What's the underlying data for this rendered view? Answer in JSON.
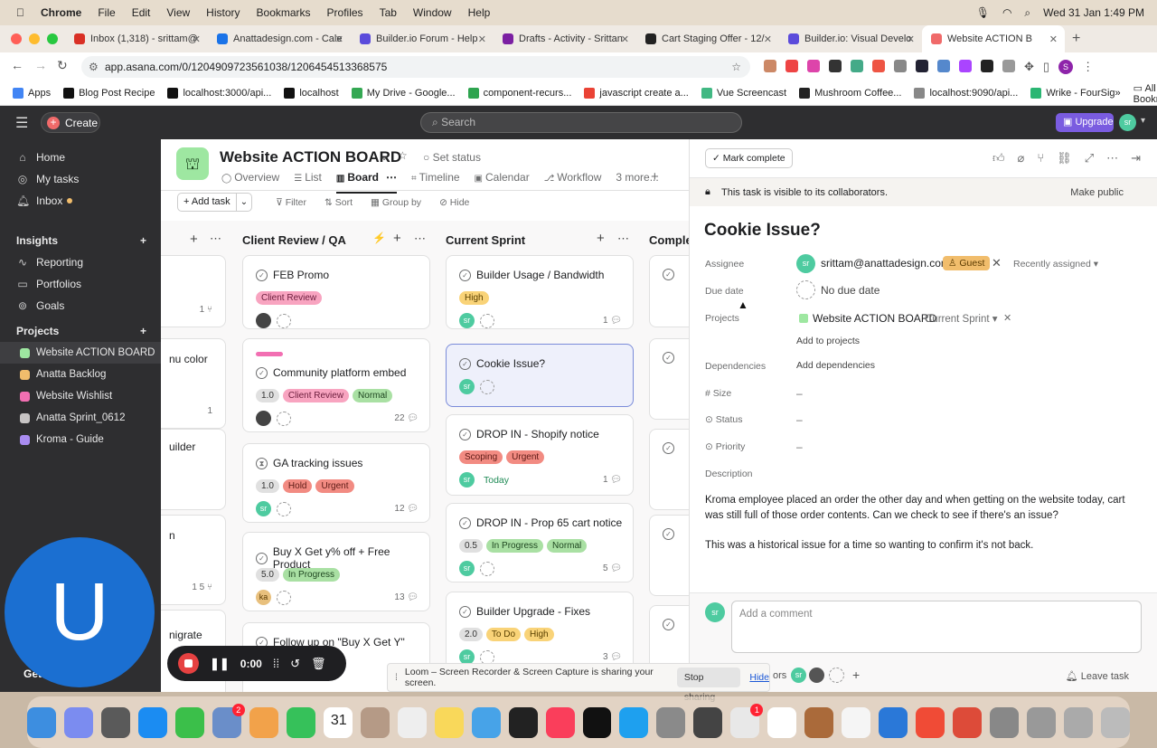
{
  "menubar": {
    "app": "Chrome",
    "items": [
      "File",
      "Edit",
      "View",
      "History",
      "Bookmarks",
      "Profiles",
      "Tab",
      "Window",
      "Help"
    ],
    "clock": "Wed 31 Jan  1:49 PM"
  },
  "tabs": [
    {
      "title": "Inbox (1,318) - srittam@",
      "color": "#d93025"
    },
    {
      "title": "Anattadesign.com - Cale",
      "color": "#1a73e8"
    },
    {
      "title": "Builder.io Forum - Help",
      "color": "#5b4bdb"
    },
    {
      "title": "Drafts - Activity - Srittan",
      "color": "#7b1fa2"
    },
    {
      "title": "Cart Staging Offer - 12/",
      "color": "#222222"
    },
    {
      "title": "Builder.io: Visual Develo",
      "color": "#5b4bdb"
    },
    {
      "title": "Website ACTION B",
      "color": "#f06a6a"
    }
  ],
  "url": "app.asana.com/0/1204909723561038/1206454513368575",
  "bookmarks": [
    {
      "label": "Apps",
      "color": "#4285f4"
    },
    {
      "label": "Blog Post Recipe",
      "color": "#111"
    },
    {
      "label": "localhost:3000/api...",
      "color": "#111"
    },
    {
      "label": "localhost",
      "color": "#111"
    },
    {
      "label": "My Drive - Google...",
      "color": "#34a853"
    },
    {
      "label": "component-recurs...",
      "color": "#2ea44f"
    },
    {
      "label": "javascript create a...",
      "color": "#ea4335"
    },
    {
      "label": "Vue Screencast",
      "color": "#41b883"
    },
    {
      "label": "Mushroom Coffee...",
      "color": "#222"
    },
    {
      "label": "localhost:9090/api...",
      "color": "#888"
    },
    {
      "label": "Wrike - FourSig",
      "color": "#2bb673"
    }
  ],
  "all_bookmarks": "All Bookmarks",
  "topbar": {
    "create": "Create",
    "search": "Search",
    "upgrade": "Upgrade",
    "user": "sr"
  },
  "sidebar": {
    "nav": [
      "Home",
      "My tasks",
      "Inbox"
    ],
    "insights_title": "Insights",
    "insights": [
      "Reporting",
      "Portfolios",
      "Goals"
    ],
    "projects_title": "Projects",
    "projects": [
      {
        "name": "Website ACTION BOARD",
        "color": "#9ee7a1"
      },
      {
        "name": "Anatta Backlog",
        "color": "#f1bd6c"
      },
      {
        "name": "Website Wishlist",
        "color": "#f26fb2"
      },
      {
        "name": "Anatta Sprint_0612",
        "color": "#c7c4c4"
      },
      {
        "name": "Kroma - Guide",
        "color": "#a98cf0"
      }
    ],
    "overlay_text": "Get started"
  },
  "project": {
    "title": "Website ACTION BOARD",
    "set_status": "Set status",
    "tabs": [
      "Overview",
      "List",
      "Board",
      "Timeline",
      "Calendar",
      "Workflow",
      "3 more..."
    ],
    "toolbar": {
      "add_task": "Add task",
      "filter": "Filter",
      "sort": "Sort",
      "group_by": "Group by",
      "hide": "Hide"
    }
  },
  "columns": [
    {
      "title": "Client Review / QA",
      "cards": [
        {
          "title": "FEB Promo",
          "tags": [
            {
              "t": "Client Review",
              "bg": "#f8a4c0",
              "fg": "#6b1d3c"
            }
          ],
          "avatar": "img",
          "count": ""
        },
        {
          "title": "Community platform embed",
          "tags": [
            {
              "t": "1.0",
              "bg": "#e0e0e0",
              "fg": "#333"
            },
            {
              "t": "Client Review",
              "bg": "#f8a4c0",
              "fg": "#6b1d3c"
            },
            {
              "t": "Normal",
              "bg": "#a9e0a3",
              "fg": "#1e4620"
            }
          ],
          "avatar": "img",
          "count": "22"
        },
        {
          "title": "GA tracking issues",
          "tags": [
            {
              "t": "1.0",
              "bg": "#e0e0e0",
              "fg": "#333"
            },
            {
              "t": "Hold",
              "bg": "#f28b82",
              "fg": "#5c1a15"
            },
            {
              "t": "Urgent",
              "bg": "#f28b82",
              "fg": "#5c1a15"
            }
          ],
          "avatar": "sr",
          "count": "12"
        },
        {
          "title": "Buy X Get y% off + Free Product",
          "tags": [
            {
              "t": "5.0",
              "bg": "#e0e0e0",
              "fg": "#333"
            },
            {
              "t": "In Progress",
              "bg": "#a9e0a3",
              "fg": "#1e4620"
            }
          ],
          "avatar": "ka",
          "count": "13"
        },
        {
          "title": "Follow up on \"Buy X Get Y\"",
          "tags": [],
          "avatar": "ka",
          "count": ""
        }
      ]
    },
    {
      "title": "Current Sprint",
      "cards": [
        {
          "title": "Builder Usage / Bandwidth",
          "tags": [
            {
              "t": "High",
              "bg": "#f9d378",
              "fg": "#5a4000"
            }
          ],
          "avatar": "sr",
          "count": "1"
        },
        {
          "title": "Cookie Issue?",
          "tags": [],
          "avatar": "sr",
          "count": ""
        },
        {
          "title": "DROP IN - Shopify notice",
          "tags": [
            {
              "t": "Scoping",
              "bg": "#f28b82",
              "fg": "#5c1a15"
            },
            {
              "t": "Urgent",
              "bg": "#f28b82",
              "fg": "#5c1a15"
            }
          ],
          "avatar": "sr",
          "due": "Today",
          "count": "1"
        },
        {
          "title": "DROP IN - Prop 65 cart notice",
          "tags": [
            {
              "t": "0.5",
              "bg": "#e0e0e0",
              "fg": "#333"
            },
            {
              "t": "In Progress",
              "bg": "#a9e0a3",
              "fg": "#1e4620"
            },
            {
              "t": "Normal",
              "bg": "#a9e0a3",
              "fg": "#1e4620"
            }
          ],
          "avatar": "sr",
          "count": "5"
        },
        {
          "title": "Builder Upgrade - Fixes",
          "tags": [
            {
              "t": "2.0",
              "bg": "#e0e0e0",
              "fg": "#333"
            },
            {
              "t": "To Do",
              "bg": "#f9d378",
              "fg": "#5a4000"
            },
            {
              "t": "High",
              "bg": "#f9d378",
              "fg": "#5a4000"
            }
          ],
          "avatar": "sr",
          "count": "3"
        }
      ]
    },
    {
      "title": "Comple"
    }
  ],
  "left_partial": [
    "nu color",
    "uilder",
    "n",
    "nigrate"
  ],
  "detail": {
    "mark_complete": "Mark complete",
    "visibility": "This task is visible to its collaborators.",
    "make_public": "Make public",
    "title": "Cookie Issue?",
    "assignee_label": "Assignee",
    "assignee": "srittam@anattadesign.com",
    "guest": "Guest",
    "recently": "Recently assigned",
    "due_label": "Due date",
    "due": "No due date",
    "projects_label": "Projects",
    "project": "Website ACTION BOARD",
    "section": "Current Sprint",
    "add_projects": "Add to projects",
    "dependencies_label": "Dependencies",
    "add_dependencies": "Add dependencies",
    "size_label": "Size",
    "size": "–",
    "status_label": "Status",
    "status": "–",
    "priority_label": "Priority",
    "priority": "–",
    "description_label": "Description",
    "description1": "Kroma employee placed an order the other day and when getting on the website today, cart was still full of those order contents. Can we check to see if there's an issue?",
    "description2": "This was a historical issue for a time so wanting to confirm it's not back.",
    "comment_placeholder": "Add a comment",
    "collaborators": "ors",
    "leave_task": "Leave task"
  },
  "loom": {
    "timer": "0:00",
    "message": "Loom – Screen Recorder & Screen Capture is sharing your screen.",
    "stop": "Stop sharing",
    "hide": "Hide",
    "avatar_letter": "U"
  },
  "dock_badges": {
    "mail": "2",
    "slack": "1"
  }
}
